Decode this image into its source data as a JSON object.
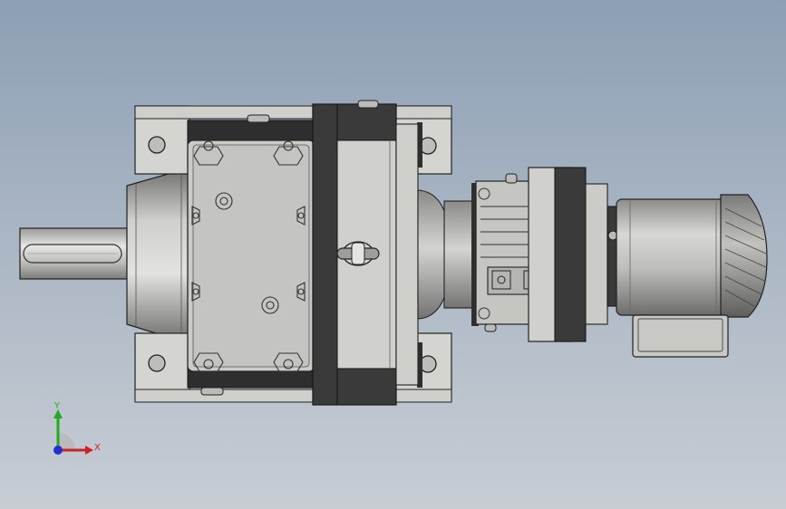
{
  "view": {
    "background_top": "#8d9fb5",
    "background_bottom": "#c8cdd4"
  },
  "model": {
    "kind": "helical gear reducer with motor",
    "body_color": "#c9c9c6",
    "dark_ring_color": "#3a3a3a"
  },
  "triad": {
    "y_label": "Y",
    "x_label": "X",
    "y_color": "#22aa22",
    "x_color": "#cc2222",
    "z_color": "#2233cc"
  }
}
